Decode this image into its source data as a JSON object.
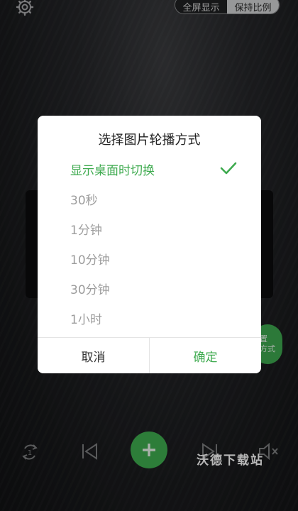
{
  "header": {
    "mode_full": "全屏显示",
    "mode_keep": "保持比例",
    "selected_mode": "保持比例"
  },
  "side_bubble": {
    "line1": "置",
    "line2": "方式"
  },
  "bottom": {
    "watermark": "沃德下载站"
  },
  "dialog": {
    "title": "选择图片轮播方式",
    "options": [
      {
        "label": "显示桌面时切换",
        "selected": true
      },
      {
        "label": "30秒",
        "selected": false
      },
      {
        "label": "1分钟",
        "selected": false
      },
      {
        "label": "10分钟",
        "selected": false
      },
      {
        "label": "30分钟",
        "selected": false
      },
      {
        "label": "1小时",
        "selected": false
      }
    ],
    "cancel_label": "取消",
    "confirm_label": "确定"
  },
  "colors": {
    "accent": "#3daa4e",
    "option_text": "#9d9d9d"
  }
}
